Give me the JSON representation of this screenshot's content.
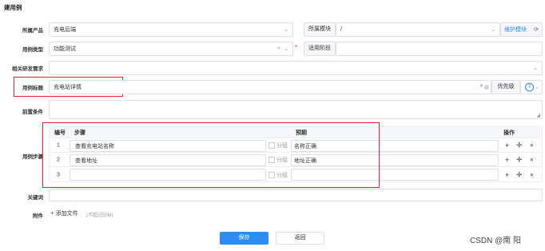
{
  "page": {
    "title": "建用例"
  },
  "form": {
    "product": {
      "label": "所属产品",
      "value": "充电后端"
    },
    "module": {
      "label": "所属模块",
      "value": "/",
      "maintain": "维护模块"
    },
    "case_type": {
      "label": "用例类型",
      "value": "功能测试",
      "stage_label": "适用阶段"
    },
    "related_req": {
      "label": "相关研发需求"
    },
    "case_title": {
      "label": "用例标题",
      "value": "充电站详情",
      "priority_label": "优先级",
      "priority_value": "3"
    },
    "precondition": {
      "label": "前置条件"
    },
    "steps": {
      "label": "用例步骤",
      "headers": {
        "num": "编号",
        "step": "步骤",
        "expect": "预期",
        "ops": "操作"
      },
      "group_label": "分组",
      "rows": [
        {
          "num": "1",
          "step": "查看充电站名称",
          "expect": "名称正确"
        },
        {
          "num": "2",
          "step": "查看地址",
          "expect": "地址正确"
        },
        {
          "num": "3",
          "step": "",
          "expect": ""
        }
      ],
      "op_icons": [
        "plus-icon",
        "move-icon",
        "close-icon"
      ]
    },
    "keywords": {
      "label": "关键词"
    },
    "attachment": {
      "label": "附件",
      "add": "添加文件",
      "limit": "(不超过50M)"
    }
  },
  "actions": {
    "save": "保存",
    "back": "返回"
  },
  "watermark": "CSDN @南 阳",
  "colors": {
    "primary": "#2d8cf0",
    "highlight": "#e3242b",
    "required": "#e33333"
  }
}
